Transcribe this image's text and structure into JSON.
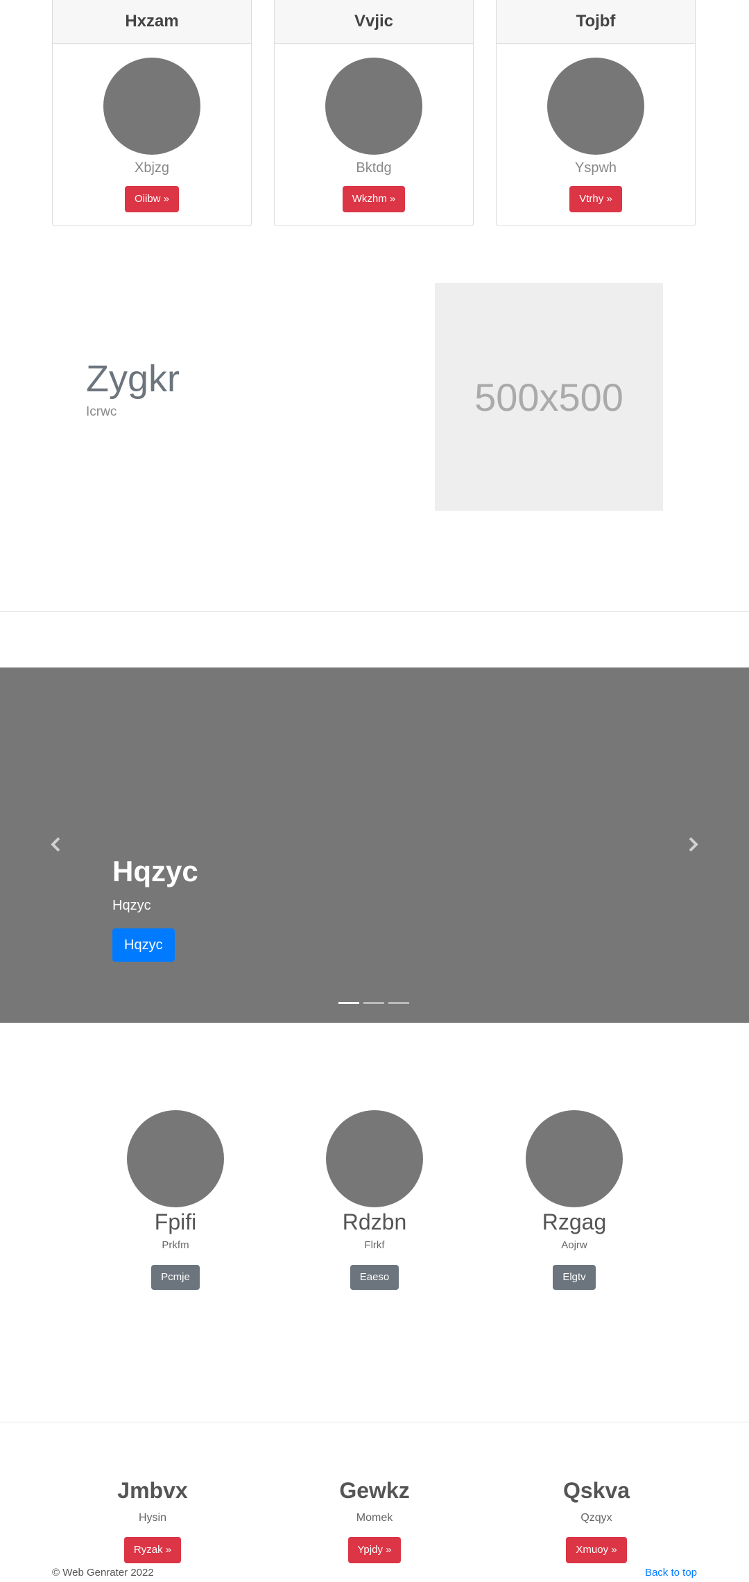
{
  "cards": [
    {
      "title": "Hxzam",
      "subtitle": "Xbjzg",
      "button": "Oiibw »"
    },
    {
      "title": "Vvjic",
      "subtitle": "Bktdg",
      "button": "Wkzhm »"
    },
    {
      "title": "Tojbf",
      "subtitle": "Yspwh",
      "button": "Vtrhy »"
    }
  ],
  "feature": {
    "title": "Zygkr",
    "subtitle": "Icrwc",
    "image_label": "500x500"
  },
  "carousel": {
    "title": "Hqzyc",
    "subtitle": "Hqzyc",
    "button": "Hqzyc",
    "prev_icon": "chevron-left-icon",
    "next_icon": "chevron-right-icon",
    "slide_count": 3,
    "active_slide": 1
  },
  "people": [
    {
      "name": "Fpifi",
      "subtitle": "Prkfm",
      "button": "Pcmje"
    },
    {
      "name": "Rdzbn",
      "subtitle": "Flrkf",
      "button": "Eaeso"
    },
    {
      "name": "Rzgag",
      "subtitle": "Aojrw",
      "button": "Elgtv"
    }
  ],
  "footer_features": [
    {
      "title": "Jmbvx",
      "subtitle": "Hysin",
      "button": "Ryzak »"
    },
    {
      "title": "Gewkz",
      "subtitle": "Momek",
      "button": "Ypjdy »"
    },
    {
      "title": "Qskva",
      "subtitle": "Qzqyx",
      "button": "Xmuoy »"
    }
  ],
  "footer": {
    "copyright": "© Web Genrater 2022",
    "back_to_top": "Back to top"
  },
  "colors": {
    "danger": "#dc3545",
    "primary": "#007bff",
    "secondary": "#6c757d",
    "placeholder": "#777777"
  }
}
